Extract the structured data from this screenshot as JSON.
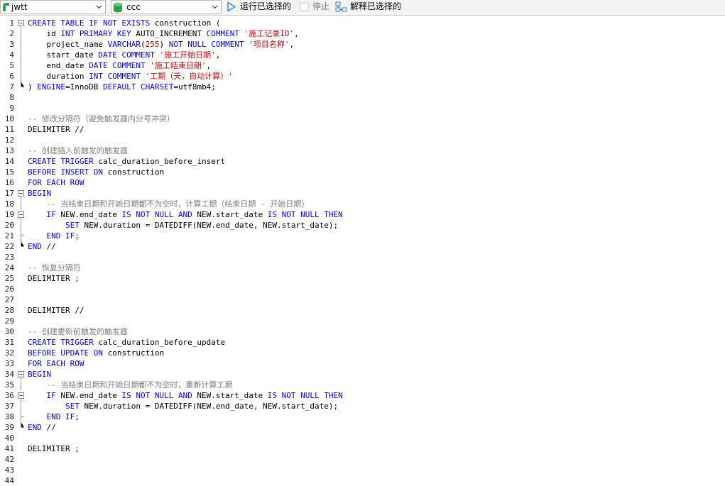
{
  "toolbar": {
    "connection": "jwtt",
    "database": "ccc",
    "run_selected": "运行已选择的",
    "stop": "停止",
    "explain_selected": "解释已选择的",
    "colors": {
      "run_icon": "#2f7fd6",
      "db_icon": "#2ea043",
      "stop_disabled": "#7a7a7a"
    }
  },
  "editor": {
    "colors": {
      "keyword": "#0000ff",
      "string": "#d20000",
      "comment": "#808080",
      "text": "#000000"
    },
    "lines": [
      {
        "n": "1",
        "fold": "open",
        "tokens": [
          {
            "t": "k",
            "v": "CREATE TABLE IF NOT EXISTS"
          },
          {
            "t": "p",
            "v": " construction ("
          }
        ]
      },
      {
        "n": "2",
        "fold": "bar",
        "tokens": [
          {
            "t": "p",
            "v": "    id "
          },
          {
            "t": "k",
            "v": "INT PRIMARY KEY"
          },
          {
            "t": "p",
            "v": " AUTO_INCREMENT "
          },
          {
            "t": "k",
            "v": "COMMENT"
          },
          {
            "t": "p",
            "v": " "
          },
          {
            "t": "s",
            "v": "'施工记录ID'"
          },
          {
            "t": "p",
            "v": ","
          }
        ]
      },
      {
        "n": "3",
        "fold": "bar",
        "tokens": [
          {
            "t": "p",
            "v": "    project_name "
          },
          {
            "t": "k",
            "v": "VARCHAR"
          },
          {
            "t": "p",
            "v": "("
          },
          {
            "t": "n",
            "v": "255"
          },
          {
            "t": "p",
            "v": ") "
          },
          {
            "t": "k",
            "v": "NOT NULL COMMENT"
          },
          {
            "t": "p",
            "v": " "
          },
          {
            "t": "s",
            "v": "'项目名称'"
          },
          {
            "t": "p",
            "v": ","
          }
        ]
      },
      {
        "n": "4",
        "fold": "bar",
        "tokens": [
          {
            "t": "p",
            "v": "    start_date "
          },
          {
            "t": "k",
            "v": "DATE COMMENT"
          },
          {
            "t": "p",
            "v": " "
          },
          {
            "t": "s",
            "v": "'施工开始日期'"
          },
          {
            "t": "p",
            "v": ","
          }
        ]
      },
      {
        "n": "5",
        "fold": "bar",
        "tokens": [
          {
            "t": "p",
            "v": "    end_date "
          },
          {
            "t": "k",
            "v": "DATE COMMENT"
          },
          {
            "t": "p",
            "v": " "
          },
          {
            "t": "s",
            "v": "'施工结束日期'"
          },
          {
            "t": "p",
            "v": ","
          }
        ]
      },
      {
        "n": "6",
        "fold": "bar",
        "tokens": [
          {
            "t": "p",
            "v": "    duration "
          },
          {
            "t": "k",
            "v": "INT COMMENT"
          },
          {
            "t": "p",
            "v": " "
          },
          {
            "t": "s",
            "v": "'工期（天，自动计算）'"
          }
        ]
      },
      {
        "n": "7",
        "fold": "end",
        "tokens": [
          {
            "t": "p",
            "v": ") "
          },
          {
            "t": "k",
            "v": "ENGINE"
          },
          {
            "t": "p",
            "v": "=InnoDB "
          },
          {
            "t": "k",
            "v": "DEFAULT CHARSET"
          },
          {
            "t": "p",
            "v": "=utf8mb4;"
          }
        ]
      },
      {
        "n": "8",
        "fold": "",
        "tokens": []
      },
      {
        "n": "9",
        "fold": "",
        "tokens": []
      },
      {
        "n": "10",
        "fold": "",
        "tokens": [
          {
            "t": "c",
            "v": "-- 修改分隔符（避免触发器内分号冲突）"
          }
        ]
      },
      {
        "n": "11",
        "fold": "",
        "tokens": [
          {
            "t": "p",
            "v": "DELIMITER //"
          }
        ]
      },
      {
        "n": "12",
        "fold": "",
        "tokens": []
      },
      {
        "n": "13",
        "fold": "",
        "tokens": [
          {
            "t": "c",
            "v": "-- 创建插入前触发的触发器"
          }
        ]
      },
      {
        "n": "14",
        "fold": "",
        "tokens": [
          {
            "t": "k",
            "v": "CREATE TRIGGER"
          },
          {
            "t": "p",
            "v": " calc_duration_before_insert"
          }
        ]
      },
      {
        "n": "15",
        "fold": "",
        "tokens": [
          {
            "t": "k",
            "v": "BEFORE INSERT ON"
          },
          {
            "t": "p",
            "v": " construction"
          }
        ]
      },
      {
        "n": "16",
        "fold": "",
        "tokens": [
          {
            "t": "k",
            "v": "FOR EACH ROW"
          }
        ]
      },
      {
        "n": "17",
        "fold": "open",
        "tokens": [
          {
            "t": "k",
            "v": "BEGIN"
          }
        ]
      },
      {
        "n": "18",
        "fold": "bar",
        "tokens": [
          {
            "t": "p",
            "v": "    "
          },
          {
            "t": "c",
            "v": "-- 当结束日期和开始日期都不为空时，计算工期（结束日期 - 开始日期）"
          }
        ]
      },
      {
        "n": "19",
        "fold": "open",
        "tokens": [
          {
            "t": "p",
            "v": "    "
          },
          {
            "t": "k",
            "v": "IF"
          },
          {
            "t": "p",
            "v": " NEW.end_date "
          },
          {
            "t": "k",
            "v": "IS NOT NULL AND"
          },
          {
            "t": "p",
            "v": " NEW.start_date "
          },
          {
            "t": "k",
            "v": "IS NOT NULL THEN"
          }
        ]
      },
      {
        "n": "20",
        "fold": "bar",
        "tokens": [
          {
            "t": "p",
            "v": "        "
          },
          {
            "t": "k",
            "v": "SET"
          },
          {
            "t": "p",
            "v": " NEW.duration = DATEDIFF(NEW.end_date, NEW.start_date);"
          }
        ]
      },
      {
        "n": "21",
        "fold": "mid",
        "tokens": [
          {
            "t": "p",
            "v": "    "
          },
          {
            "t": "k",
            "v": "END IF"
          },
          {
            "t": "p",
            "v": ";"
          }
        ]
      },
      {
        "n": "22",
        "fold": "end",
        "tokens": [
          {
            "t": "k",
            "v": "END"
          },
          {
            "t": "p",
            "v": " //"
          }
        ]
      },
      {
        "n": "23",
        "fold": "",
        "tokens": []
      },
      {
        "n": "24",
        "fold": "",
        "tokens": [
          {
            "t": "c",
            "v": "-- 恢复分隔符"
          }
        ]
      },
      {
        "n": "25",
        "fold": "",
        "tokens": [
          {
            "t": "p",
            "v": "DELIMITER ;"
          }
        ]
      },
      {
        "n": "26",
        "fold": "",
        "tokens": []
      },
      {
        "n": "27",
        "fold": "",
        "tokens": []
      },
      {
        "n": "28",
        "fold": "",
        "tokens": [
          {
            "t": "p",
            "v": "DELIMITER //"
          }
        ]
      },
      {
        "n": "29",
        "fold": "",
        "tokens": []
      },
      {
        "n": "30",
        "fold": "",
        "tokens": [
          {
            "t": "c",
            "v": "-- 创建更新前触发的触发器"
          }
        ]
      },
      {
        "n": "31",
        "fold": "",
        "tokens": [
          {
            "t": "k",
            "v": "CREATE TRIGGER"
          },
          {
            "t": "p",
            "v": " calc_duration_before_update"
          }
        ]
      },
      {
        "n": "32",
        "fold": "",
        "tokens": [
          {
            "t": "k",
            "v": "BEFORE UPDATE ON"
          },
          {
            "t": "p",
            "v": " construction"
          }
        ]
      },
      {
        "n": "33",
        "fold": "",
        "tokens": [
          {
            "t": "k",
            "v": "FOR EACH ROW"
          }
        ]
      },
      {
        "n": "34",
        "fold": "open",
        "tokens": [
          {
            "t": "k",
            "v": "BEGIN"
          }
        ]
      },
      {
        "n": "35",
        "fold": "bar",
        "tokens": [
          {
            "t": "p",
            "v": "    "
          },
          {
            "t": "c",
            "v": "-- 当结束日期和开始日期都不为空时，重新计算工期"
          }
        ]
      },
      {
        "n": "36",
        "fold": "open",
        "tokens": [
          {
            "t": "p",
            "v": "    "
          },
          {
            "t": "k",
            "v": "IF"
          },
          {
            "t": "p",
            "v": " NEW.end_date "
          },
          {
            "t": "k",
            "v": "IS NOT NULL AND"
          },
          {
            "t": "p",
            "v": " NEW.start_date "
          },
          {
            "t": "k",
            "v": "IS NOT NULL THEN"
          }
        ]
      },
      {
        "n": "37",
        "fold": "bar",
        "tokens": [
          {
            "t": "p",
            "v": "        "
          },
          {
            "t": "k",
            "v": "SET"
          },
          {
            "t": "p",
            "v": " NEW.duration = DATEDIFF(NEW.end_date, NEW.start_date);"
          }
        ]
      },
      {
        "n": "38",
        "fold": "mid",
        "tokens": [
          {
            "t": "p",
            "v": "    "
          },
          {
            "t": "k",
            "v": "END IF"
          },
          {
            "t": "p",
            "v": ";"
          }
        ]
      },
      {
        "n": "39",
        "fold": "end",
        "tokens": [
          {
            "t": "k",
            "v": "END"
          },
          {
            "t": "p",
            "v": " //"
          }
        ]
      },
      {
        "n": "40",
        "fold": "",
        "tokens": []
      },
      {
        "n": "41",
        "fold": "",
        "tokens": [
          {
            "t": "p",
            "v": "DELIMITER ;"
          }
        ]
      },
      {
        "n": "42",
        "fold": "",
        "tokens": []
      },
      {
        "n": "43",
        "fold": "",
        "tokens": []
      },
      {
        "n": "44",
        "fold": "",
        "tokens": []
      }
    ]
  }
}
